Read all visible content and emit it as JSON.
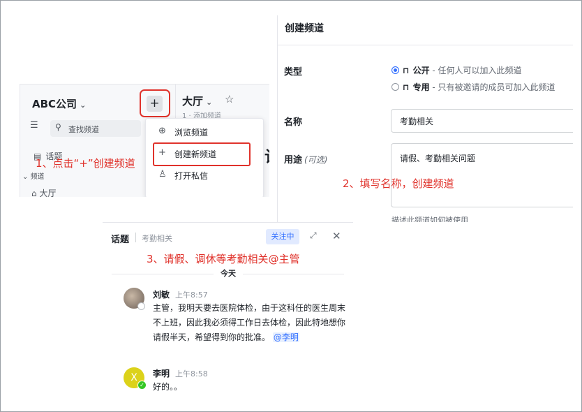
{
  "panel1": {
    "workspace_name": "ABC公司",
    "chevron": "⌄",
    "plus": "+",
    "channel_title": "大厅",
    "star": "☆",
    "channel_sub": "1    ·    添加频道",
    "filter_icon": "filter-icon",
    "search_placeholder": "查找频道",
    "topic_label": "话题",
    "channels_header": "频道",
    "hall_item": "大厅",
    "big_glyph": "讪",
    "menu": {
      "items": [
        {
          "icon": "⊕",
          "label": "浏览频道"
        },
        {
          "icon": "+",
          "label": "创建新频道"
        },
        {
          "icon": "♙",
          "label": "打开私信"
        }
      ]
    },
    "step_annotation": "1、点击“+”创建频道"
  },
  "panel2": {
    "title": "创建频道",
    "type_label": "类型",
    "options": [
      {
        "name": "公开",
        "desc": " - 任何人可以加入此频道",
        "selected": true,
        "lock": "🔓"
      },
      {
        "name": "专用",
        "desc": " - 只有被邀请的成员可加入此频道",
        "selected": false,
        "lock": "🔒"
      }
    ],
    "name_label": "名称",
    "name_value": "考勤相关",
    "purpose_label": "用途",
    "purpose_optional": "(可选)",
    "purpose_value": "请假、考勤相关问题",
    "hint": "描述此频道如何被使用",
    "step_annotation": "2、填写名称，创建频道"
  },
  "panel3": {
    "title": "话题",
    "subtitle": "考勤相关",
    "follow_label": "关注中",
    "expand": "⤢",
    "close": "✕",
    "step_annotation": "3、请假、调休等考勤相关@主管",
    "day_label": "今天",
    "messages": [
      {
        "author": "刘敏",
        "time": "上午8:57",
        "text": "主管，我明天要去医院体检，由于这科任的医生周末不上班，因此我必须得工作日去体检，因此特地想你请假半天，希望得到你的批准。",
        "mention": "@李明"
      },
      {
        "author": "李明",
        "avatar_letter": "X",
        "time": "上午8:58",
        "text": "好的。。"
      }
    ]
  },
  "colors": {
    "annotation_red": "#e0322b",
    "accent_blue": "#3370ff"
  }
}
